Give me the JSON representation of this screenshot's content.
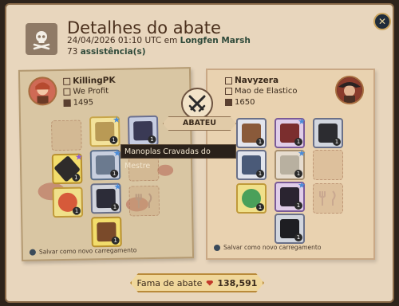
{
  "header": {
    "title": "Detalhes do abate",
    "date_prefix": "24/04/2026 01:10 UTC em",
    "location": "Longfen Marsh",
    "assist_count": "73",
    "assist_label": "assistência(s)"
  },
  "killer": {
    "name": "KillingPK",
    "guild": "We Profit",
    "ip": "1495",
    "save_label": "Salvar como novo carregamento"
  },
  "victim": {
    "name": "Navyzera",
    "guild": "Mao de Elastico",
    "ip": "1650",
    "save_label": "Salvar como novo carregamento"
  },
  "center": {
    "kill_label": "ABATEU"
  },
  "tooltip": {
    "text": "Manoplas Cravadas do Mestre"
  },
  "footer": {
    "fame_label": "Fama de abate",
    "fame_value": "138,591"
  },
  "icons": [
    "skull-crossbones-icon",
    "close-icon",
    "crossed-swords-icon",
    "fame-gem-icon",
    "guild-icon",
    "item-power-icon",
    "save-icon"
  ],
  "colors": {
    "panel": "#e8d6bd",
    "title": "#4a2f1c",
    "accent_gold": "#c9a35c",
    "star_blue": "#4a8bd8"
  }
}
